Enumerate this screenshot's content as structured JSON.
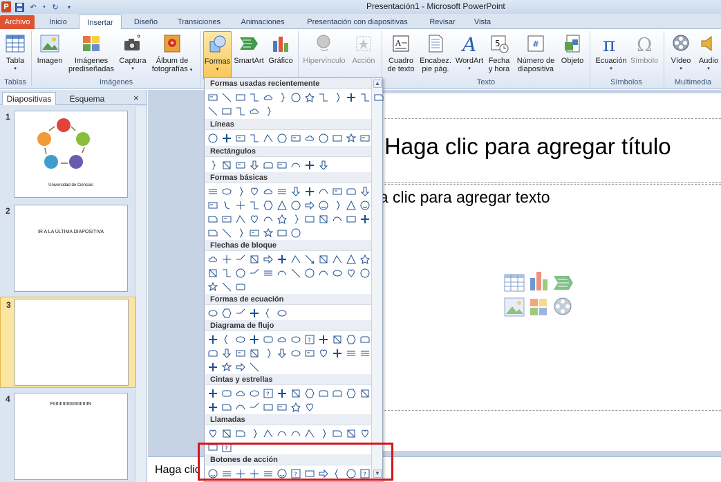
{
  "window": {
    "title": "Presentación1  -  Microsoft PowerPoint"
  },
  "ribbon_tabs": [
    "Archivo",
    "Inicio",
    "Insertar",
    "Diseño",
    "Transiciones",
    "Animaciones",
    "Presentación con diapositivas",
    "Revisar",
    "Vista"
  ],
  "ribbon": {
    "tabla": "Tabla",
    "imagen": "Imagen",
    "imagenes_1": "Imágenes",
    "imagenes_2": "prediseñadas",
    "captura": "Captura",
    "album_1": "Álbum de",
    "album_2": "fotografías",
    "formas": "Formas",
    "smartart": "SmartArt",
    "grafico": "Gráfico",
    "hipervinculo": "Hipervínculo",
    "accion": "Acción",
    "cuadro_1": "Cuadro",
    "cuadro_2": "de texto",
    "encabez_1": "Encabez.",
    "encabez_2": "pie pág.",
    "wordart": "WordArt",
    "fecha_1": "Fecha",
    "fecha_2": "y hora",
    "numero_1": "Número de",
    "numero_2": "diapositiva",
    "objeto": "Objeto",
    "ecuacion": "Ecuación",
    "simbolo": "Símbolo",
    "video": "Vídeo",
    "audio": "Audio",
    "groups": {
      "tablas": "Tablas",
      "imagenes": "Imágenes",
      "texto": "Texto",
      "simbolos": "Símbolos",
      "multimedia": "Multimedia"
    }
  },
  "left_pane": {
    "tab_slides": "Diapositivas",
    "tab_outline": "Esquema",
    "close": "×",
    "slides": [
      {
        "num": "1",
        "caption": "Universidad de Ciencias"
      },
      {
        "num": "2",
        "caption": "IR A LA ÚLTIMA DIAPOSITIVA"
      },
      {
        "num": "3",
        "caption": ""
      },
      {
        "num": "4",
        "caption": "FIIIIIIIIIIIIIIIIIIIIIIIIIIN"
      }
    ]
  },
  "slide": {
    "title_placeholder": "Haga clic para agregar título",
    "body_placeholder": "ga clic para agregar texto"
  },
  "notes": {
    "placeholder": "Haga clic"
  },
  "gallery": {
    "sections": [
      "Formas usadas recientemente",
      "Líneas",
      "Rectángulos",
      "Formas básicas",
      "Flechas de bloque",
      "Formas de ecuación",
      "Diagrama de flujo",
      "Cintas y estrellas",
      "Llamadas",
      "Botones de acción"
    ]
  },
  "colors": {
    "accent": "#e0532f",
    "highlight": "#d4161f",
    "selection": "#f9c65a"
  }
}
